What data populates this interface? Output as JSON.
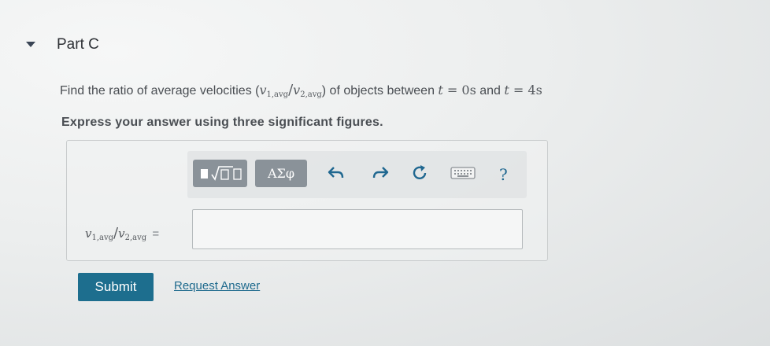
{
  "part": {
    "title": "Part C"
  },
  "question": {
    "text_before": "Find the ratio of average velocities (",
    "v": "v",
    "sub1": "1,avg",
    "slash": "/",
    "sub2": "2,avg",
    "text_after": ") of objects between ",
    "t": "t",
    "eq": " = ",
    "t_start": "0s",
    "and": " and ",
    "t_end": "4s"
  },
  "instruction": "Express your answer using three significant figures.",
  "toolbar": {
    "symbols_label": "ΑΣφ",
    "help_label": "?"
  },
  "answer": {
    "label_sub1": "1,avg",
    "label_sub2": "2,avg",
    "label_eq": "=",
    "input_value": ""
  },
  "actions": {
    "submit_label": "Submit",
    "request_label": "Request Answer"
  },
  "icons": {
    "toggle": "caret-down-icon",
    "undo": "undo-icon",
    "redo": "redo-icon",
    "reset": "reset-icon",
    "keyboard": "keyboard-icon",
    "help": "help-icon"
  }
}
